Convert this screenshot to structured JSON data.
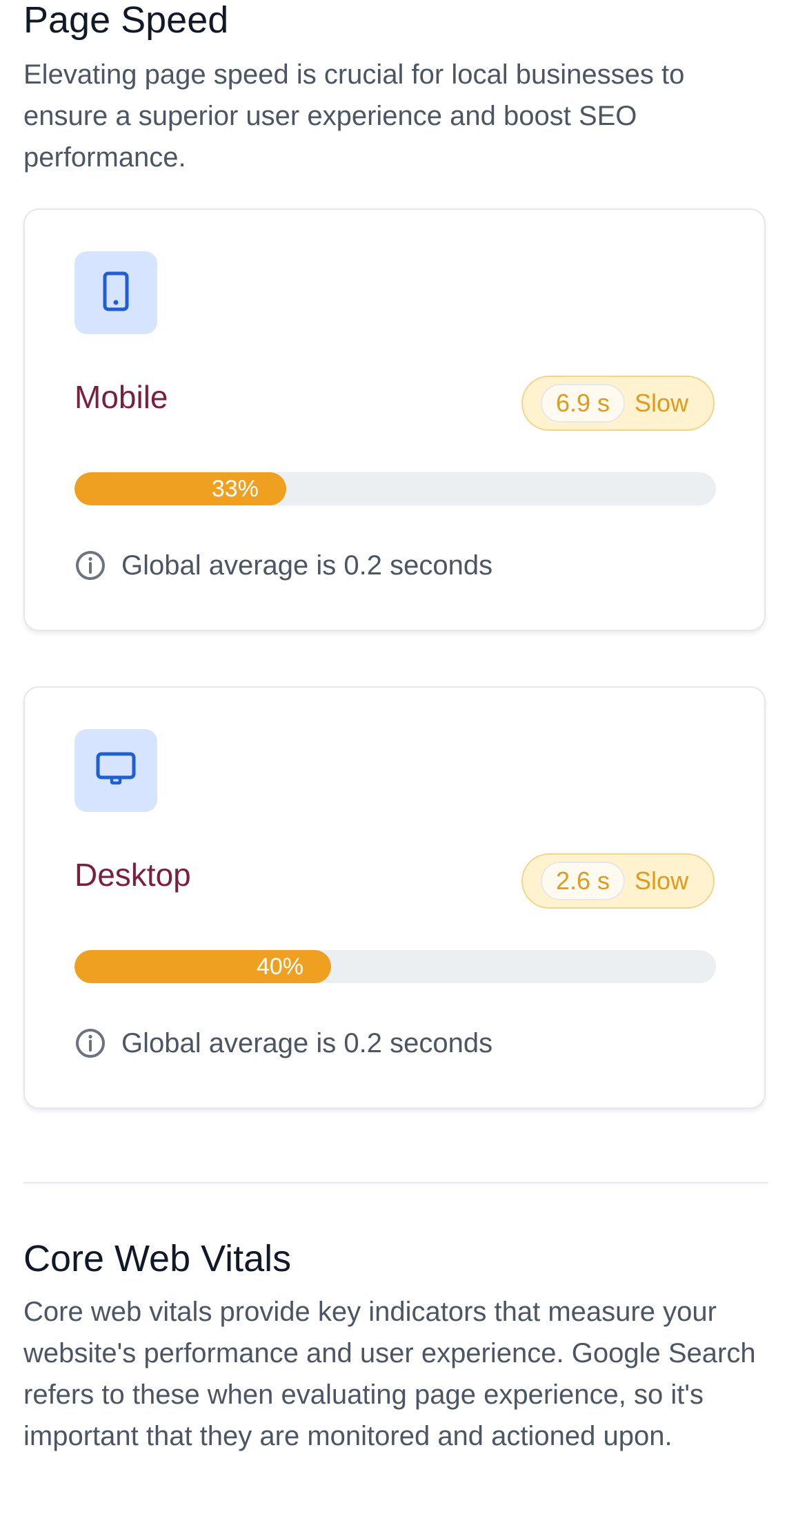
{
  "page_speed": {
    "title": "Page Speed",
    "description": "Elevating page speed is crucial for local businesses to ensure a superior user experience and boost SEO performance."
  },
  "mobile": {
    "icon": "mobile-icon",
    "title": "Mobile",
    "time": "6.9 s",
    "status": "Slow",
    "progress_label": "33%",
    "progress_value": 33,
    "note": "Global average is 0.2 seconds"
  },
  "desktop": {
    "icon": "desktop-icon",
    "title": "Desktop",
    "time": "2.6 s",
    "status": "Slow",
    "progress_label": "40%",
    "progress_value": 40,
    "note": "Global average is 0.2 seconds"
  },
  "core_web_vitals": {
    "title": "Core Web Vitals",
    "description": "Core web vitals provide key indicators that measure your website's performance and user experience. Google Search refers to these when evaluating page experience, so it's important that they are monitored and actioned upon."
  },
  "colors": {
    "accent_orange": "#f0a020",
    "status_text": "#e09a1c",
    "device_title": "#7a1f3d",
    "icon_tile": "#d6e4ff",
    "icon_blue": "#1f5fd1"
  }
}
